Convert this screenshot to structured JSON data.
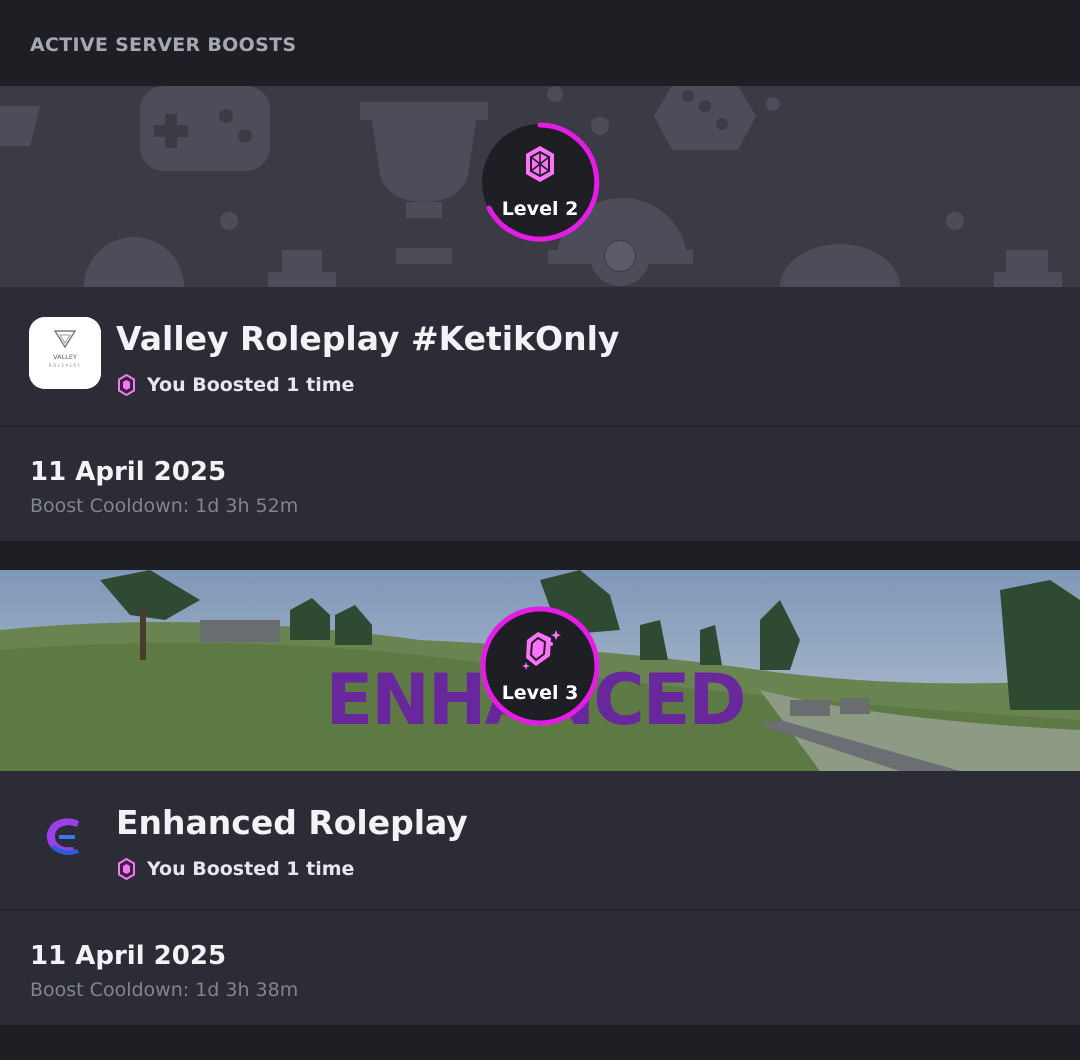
{
  "header": {
    "title": "ACTIVE SERVER BOOSTS"
  },
  "boosts": [
    {
      "server_name": "Valley Roleplay #KetikOnly",
      "level_label": "Level 2",
      "boost_text": "You Boosted 1 time",
      "date": "11 April 2025",
      "cooldown": "Boost Cooldown: 1d 3h 52m",
      "icon_text_top": "VALLEY",
      "icon_text_bottom": "ROLEPLAY",
      "level_progress": 0.62
    },
    {
      "server_name": "Enhanced Roleplay",
      "level_label": "Level 3",
      "boost_text": "You Boosted 1 time",
      "date": "11 April 2025",
      "cooldown": "Boost Cooldown: 1d 3h 38m",
      "banner_text": "ENHANCED",
      "level_progress": 1.0
    }
  ],
  "colors": {
    "accent": "#e41ce6",
    "gem": "#ff73fa",
    "background": "#1e1f25",
    "card": "#2b2c35"
  }
}
